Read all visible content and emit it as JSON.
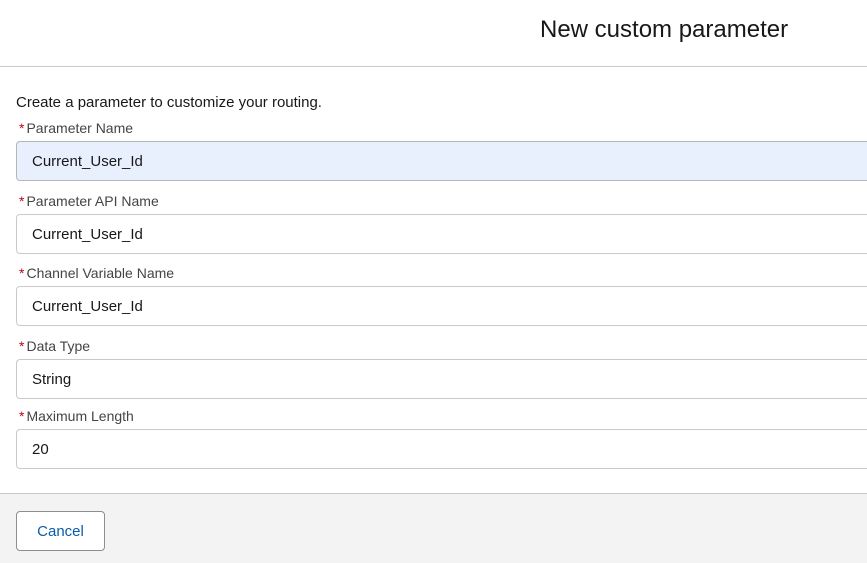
{
  "modal": {
    "title": "New custom parameter"
  },
  "form": {
    "intro": "Create a parameter to customize your routing.",
    "required_marker": "*",
    "fields": [
      {
        "label": "Parameter Name",
        "value": "Current_User_Id"
      },
      {
        "label": "Parameter API Name",
        "value": "Current_User_Id"
      },
      {
        "label": "Channel Variable Name",
        "value": "Current_User_Id"
      },
      {
        "label": "Data Type",
        "value": "String"
      },
      {
        "label": "Maximum Length",
        "value": "20"
      }
    ]
  },
  "footer": {
    "cancel_label": "Cancel"
  },
  "colors": {
    "required": "#ba0517",
    "link_blue": "#0b5cab",
    "focused_input_bg": "#e8f0fe",
    "footer_bg": "#f3f3f3"
  }
}
